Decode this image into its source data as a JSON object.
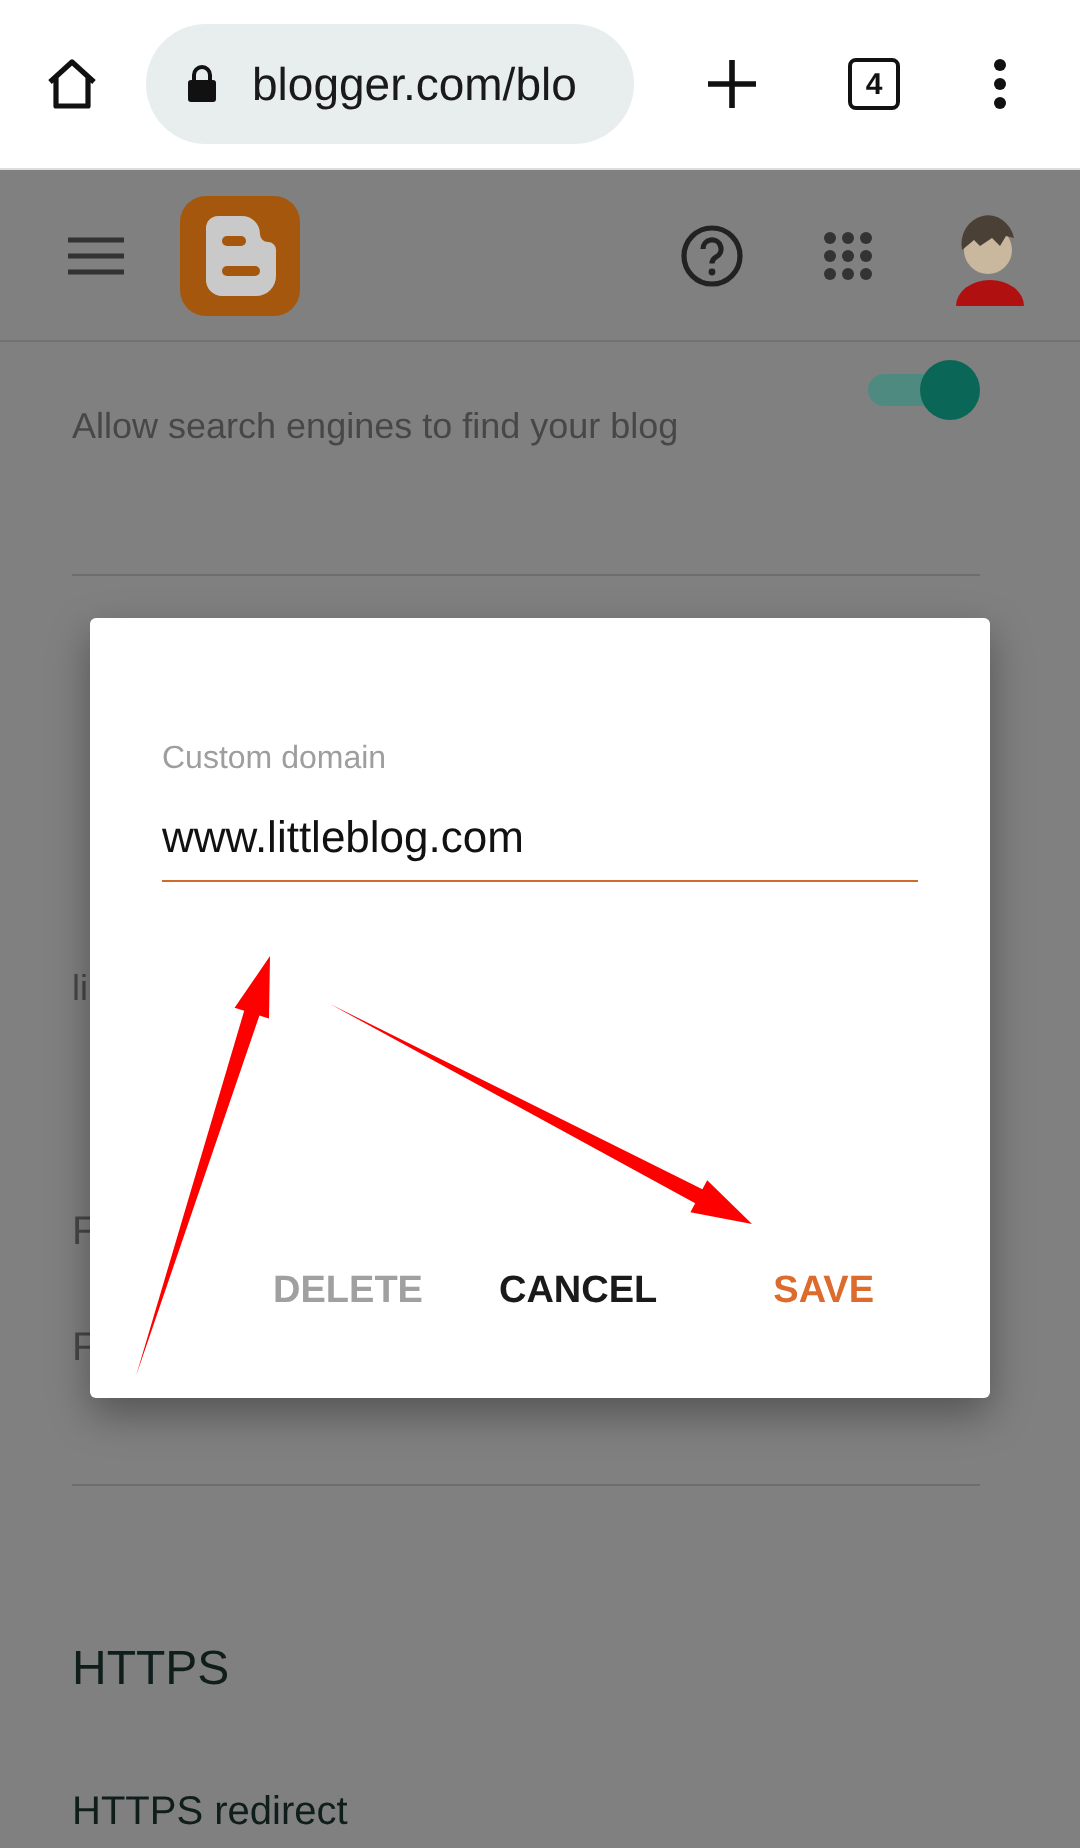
{
  "browser": {
    "url": "blogger.com/blo",
    "tab_count": "4"
  },
  "visibility": {
    "description": "Allow search engines to find your blog",
    "toggle": {
      "on": true
    }
  },
  "covered_section": [
    {
      "kind": "description",
      "text": "li"
    },
    {
      "kind": "option",
      "text": "F"
    },
    {
      "kind": "option",
      "text": "F"
    }
  ],
  "https": {
    "title": "HTTPS",
    "item": "HTTPS redirect"
  },
  "dialog": {
    "field": {
      "label": "Custom domain",
      "value": "www.littleblog.com"
    },
    "buttons": [
      {
        "label": "DELETE",
        "disabled": true,
        "primary": false
      },
      {
        "label": "CANCEL",
        "disabled": false,
        "primary": false
      },
      {
        "label": "SAVE",
        "disabled": false,
        "primary": true
      }
    ]
  }
}
